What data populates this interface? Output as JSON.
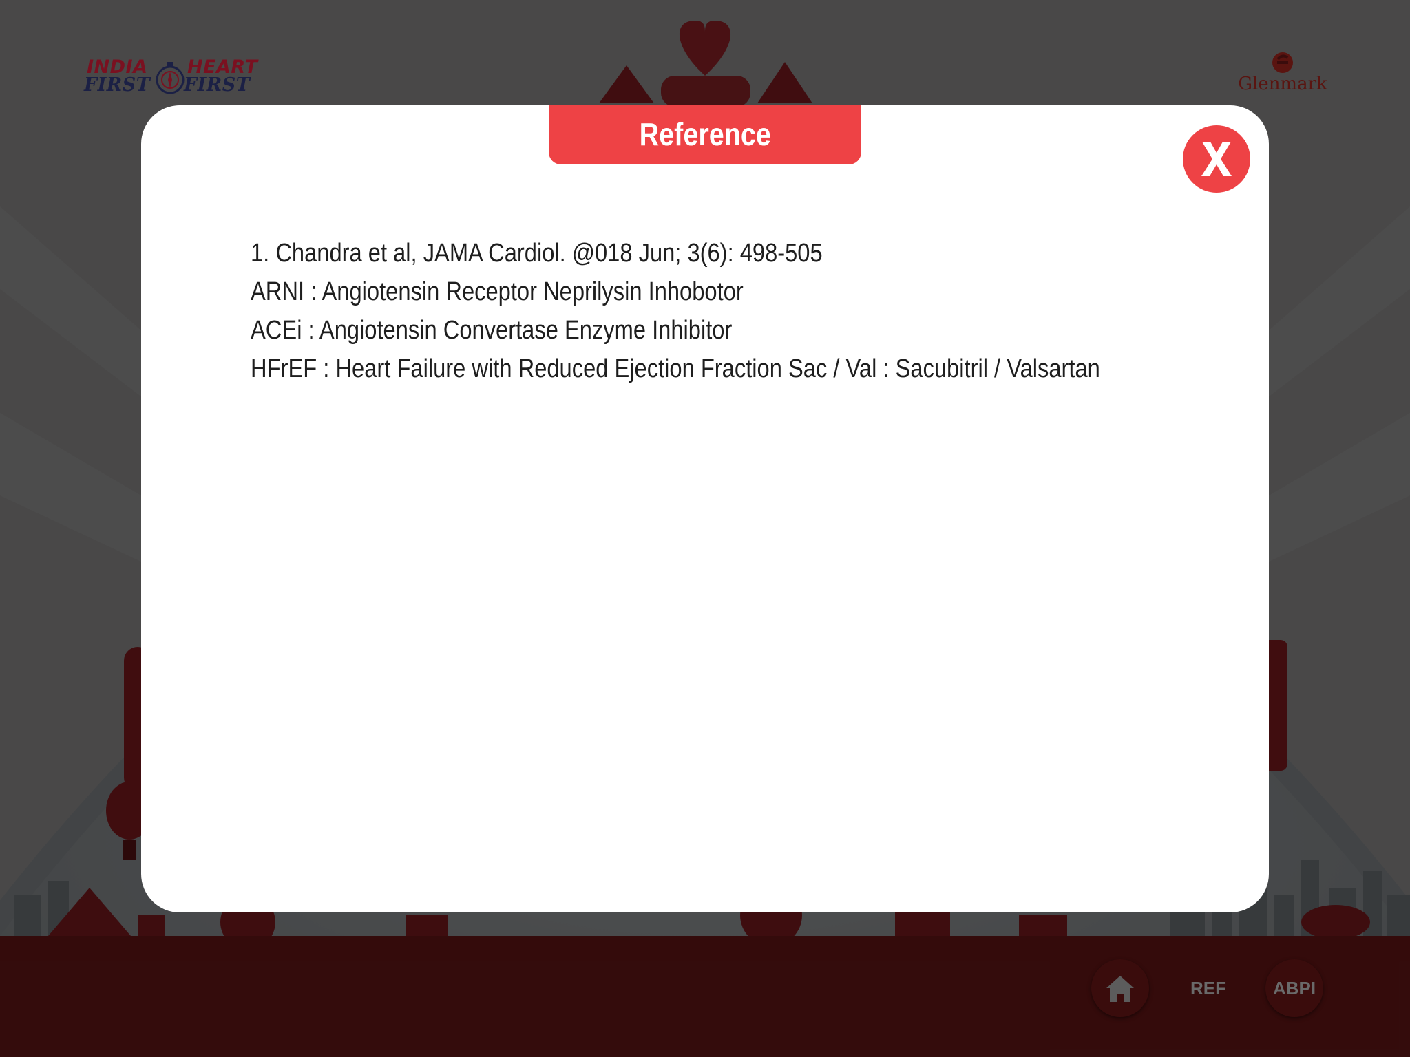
{
  "header": {
    "left_logo": {
      "line1_left": "INDIA",
      "line1_right": "HEART",
      "line2_left": "FIRST",
      "line2_right": "FIRST"
    },
    "right_logo": {
      "wordmark": "Glenmark"
    }
  },
  "modal": {
    "title": "Reference",
    "close_label": "X",
    "references": [
      "1. Chandra et al, JAMA Cardiol. @018 Jun; 3(6): 498-505",
      "ARNI : Angiotensin Receptor Neprilysin Inhobotor",
      "ACEi : Angiotensin Convertase Enzyme Inhibitor",
      "HFrEF : Heart Failure with Reduced Ejection Fraction Sac / Val : Sacubitril / Valsartan"
    ]
  },
  "bottom_nav": {
    "home_icon": "home-icon",
    "ref_label": "REF",
    "abpi_label": "ABPI"
  },
  "colors": {
    "accent": "#ee4245",
    "ground": "#4a1717",
    "overlay": "rgba(0,0,0,0.68)"
  }
}
